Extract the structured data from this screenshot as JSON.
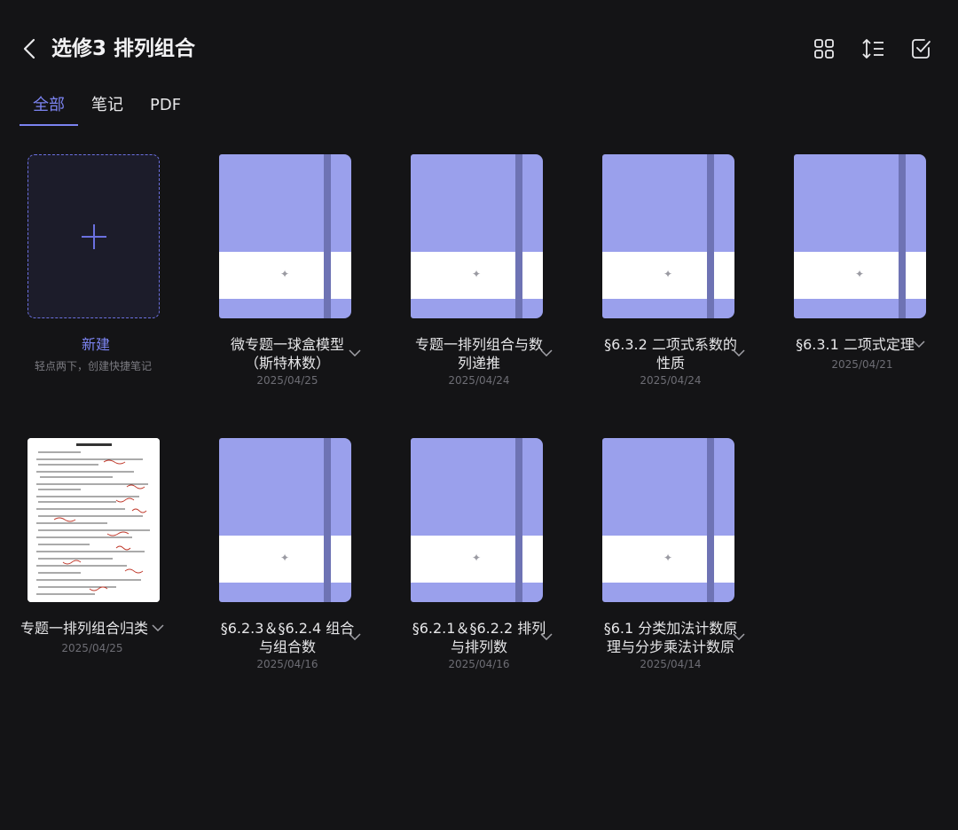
{
  "header": {
    "title": "选修3 排列组合",
    "back_icon": "chevron-left-icon",
    "actions": [
      {
        "name": "grid-view-icon"
      },
      {
        "name": "sort-icon"
      },
      {
        "name": "select-checkbox-icon"
      }
    ]
  },
  "tabs": [
    {
      "label": "全部",
      "active": true
    },
    {
      "label": "笔记",
      "active": false
    },
    {
      "label": "PDF",
      "active": false
    }
  ],
  "new_item": {
    "label": "新建",
    "hint": "轻点两下，创建快捷笔记"
  },
  "items": [
    {
      "title": "微专题一球盒模型（斯特林数）",
      "line1": "微专题一球盒模型",
      "line2": "（斯特林数）",
      "date": "2025/04/25",
      "type": "notebook"
    },
    {
      "title": "专题一排列组合与数列递推",
      "line1": "专题一排列组合与数",
      "line2": "列递推",
      "date": "2025/04/24",
      "type": "notebook"
    },
    {
      "title": "§6.3.2 二项式系数的性质",
      "line1": "§6.3.2 二项式系数的",
      "line2": "性质",
      "date": "2025/04/24",
      "type": "notebook"
    },
    {
      "title": "§6.3.1 二项式定理",
      "line1": "§6.3.1 二项式定理",
      "line2": "",
      "date": "2025/04/21",
      "type": "notebook"
    },
    {
      "title": "专题一排列组合归类",
      "line1": "专题一排列组合归类",
      "line2": "",
      "date": "2025/04/25",
      "type": "pdf"
    },
    {
      "title": "§6.2.3＆§6.2.4 组合与组合数",
      "line1": "§6.2.3＆§6.2.4 组合",
      "line2": "与组合数",
      "date": "2025/04/16",
      "type": "notebook"
    },
    {
      "title": "§6.2.1＆§6.2.2 排列与排列数",
      "line1": "§6.2.1＆§6.2.2 排列",
      "line2": "与排列数",
      "date": "2025/04/16",
      "type": "notebook"
    },
    {
      "title": "§6.1 分类加法计数原理与分步乘法计数原",
      "line1": "§6.1 分类加法计数原",
      "line2": "理与分步乘法计数原",
      "date": "2025/04/14",
      "type": "notebook"
    }
  ],
  "colors": {
    "background": "#141416",
    "accent": "#7b83f0",
    "notebook_cover": "#9aa0ec",
    "notebook_strap": "#6e73b4"
  }
}
